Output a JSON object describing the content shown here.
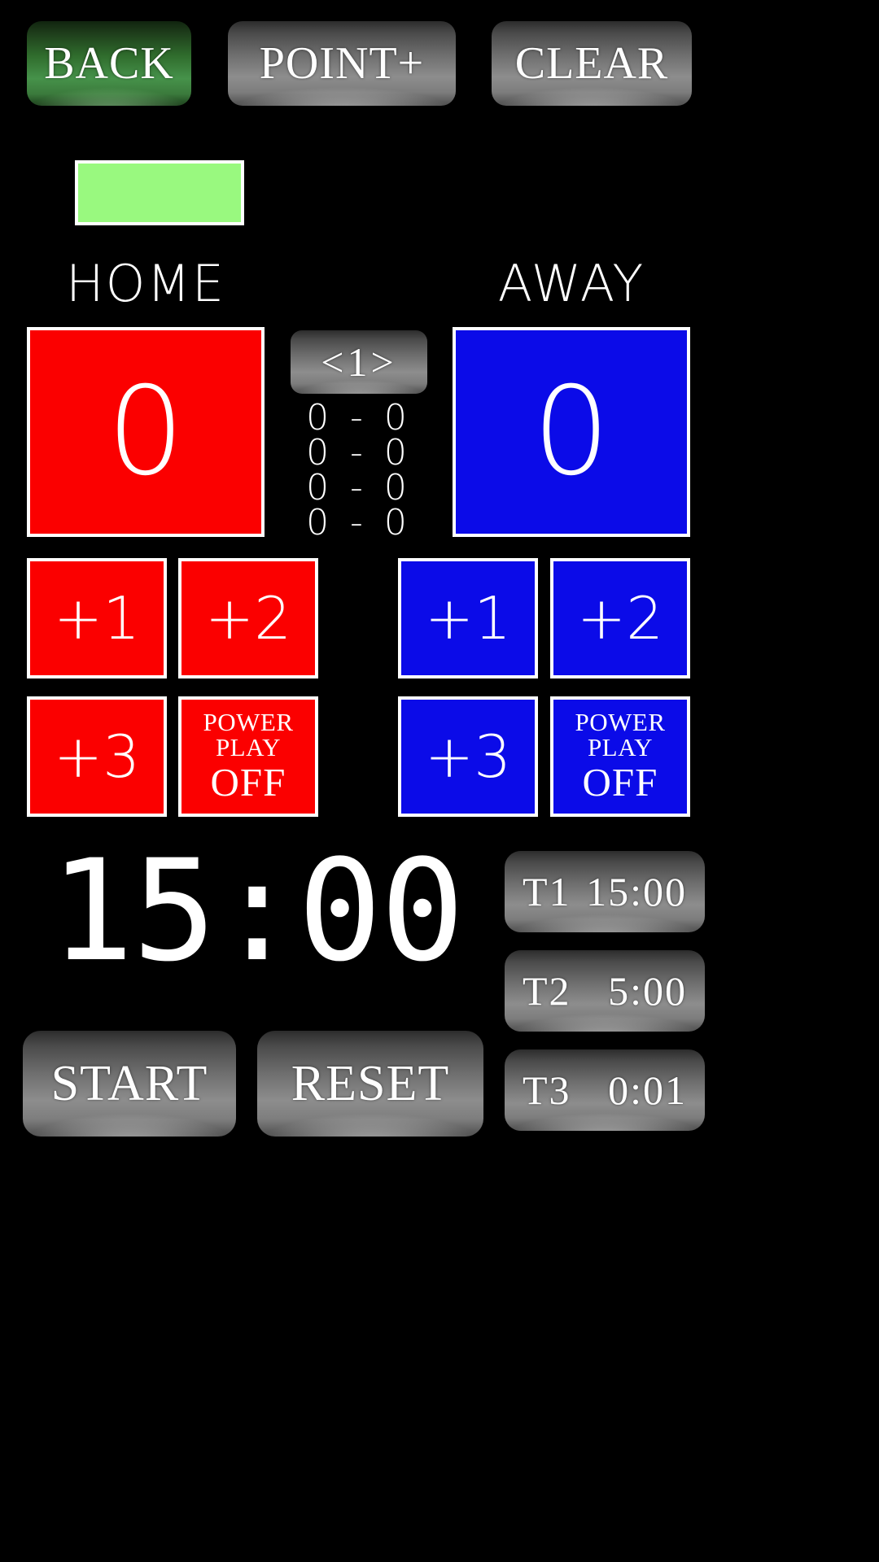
{
  "toolbar": {
    "back_label": "BACK",
    "point_label": "POINT+",
    "clear_label": "CLEAR"
  },
  "status": {
    "swatch_color": "#99f97f"
  },
  "teams": {
    "home": {
      "name": "HOME",
      "score": "0",
      "accent": "#fb0000",
      "plus1": "+1",
      "plus2": "+2",
      "plus3": "+3",
      "powerplay_title_line1": "POWER",
      "powerplay_title_line2": "PLAY",
      "powerplay_state": "OFF"
    },
    "away": {
      "name": "AWAY",
      "score": "0",
      "accent": "#0b0be8",
      "plus1": "+1",
      "plus2": "+2",
      "plus3": "+3",
      "powerplay_title_line1": "POWER",
      "powerplay_title_line2": "PLAY",
      "powerplay_state": "OFF"
    }
  },
  "period": {
    "prev_arrow": "<",
    "current": "1",
    "next_arrow": ">",
    "lines": [
      "0 - 0",
      "0 - 0",
      "0 - 0",
      "0 - 0"
    ]
  },
  "clock": {
    "time": "15:00",
    "start_label": "START",
    "reset_label": "RESET"
  },
  "presets": [
    {
      "label": "T1",
      "time": "15:00"
    },
    {
      "label": "T2",
      "time": "5:00"
    },
    {
      "label": "T3",
      "time": "0:01"
    }
  ]
}
